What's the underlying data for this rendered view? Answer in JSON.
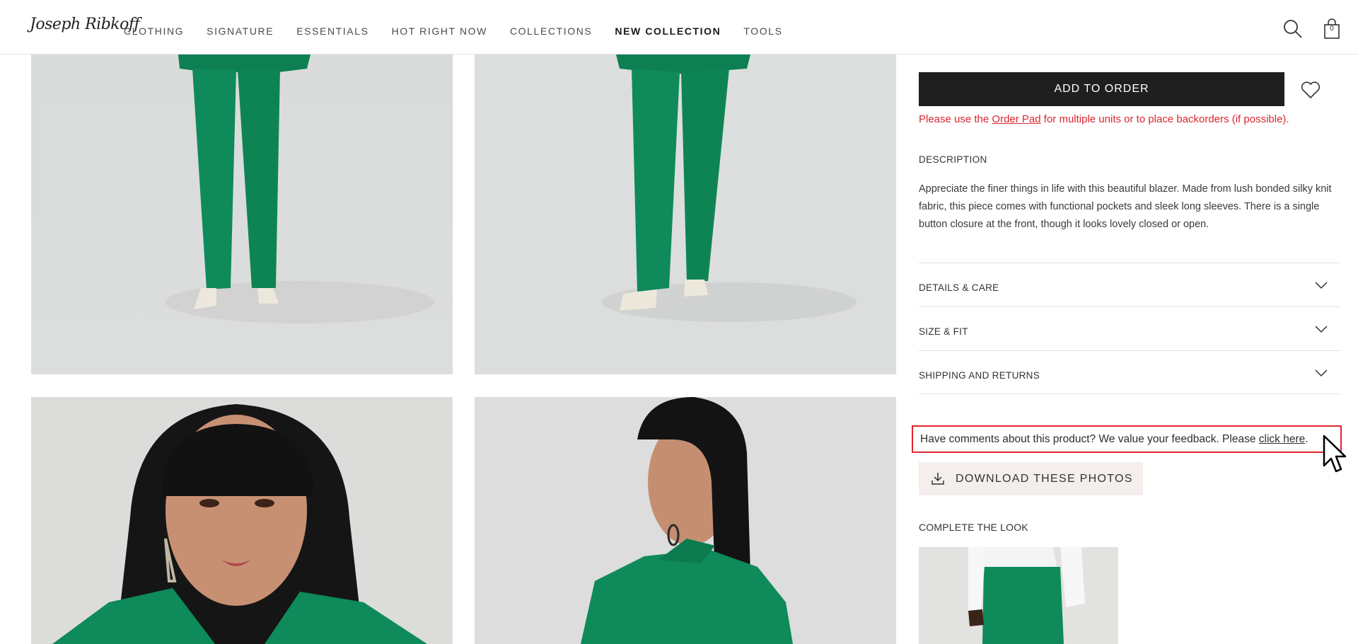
{
  "header": {
    "logo_text": "Joseph Ribkoff",
    "nav": [
      {
        "label": "CLOTHING"
      },
      {
        "label": "SIGNATURE"
      },
      {
        "label": "ESSENTIALS"
      },
      {
        "label": "HOT RIGHT NOW"
      },
      {
        "label": "COLLECTIONS"
      },
      {
        "label": "NEW COLLECTION",
        "active": true
      },
      {
        "label": "TOOLS"
      }
    ],
    "cart_count": "0",
    "icons": [
      "search-icon",
      "shopping-bag-icon"
    ]
  },
  "product": {
    "add_to_order": "ADD TO ORDER",
    "order_note_prefix": "Please use the ",
    "order_note_link": "Order Pad",
    "order_note_suffix": " for multiple units or to place backorders (if possible).",
    "description_title": "DESCRIPTION",
    "description": "Appreciate the finer things in life with this beautiful blazer. Made from lush bonded silky knit fabric, this piece comes with functional pockets and sleek long sleeves. There is a single button closure at the front, though it looks lovely closed or open.",
    "accordions": [
      {
        "label": "DETAILS & CARE"
      },
      {
        "label": "SIZE & FIT"
      },
      {
        "label": "SHIPPING AND RETURNS"
      }
    ],
    "feedback_text": "Have comments about this product? We value your feedback. Please ",
    "feedback_link": "click here",
    "feedback_end": ".",
    "download_label": "DOWNLOAD THESE PHOTOS",
    "complete_look_title": "COMPLETE THE LOOK"
  },
  "colors": {
    "accent_red": "#e1252f",
    "button_dark": "#1f1f1f",
    "garment_green": "#0f8a5a",
    "download_bg": "#f4efec"
  }
}
